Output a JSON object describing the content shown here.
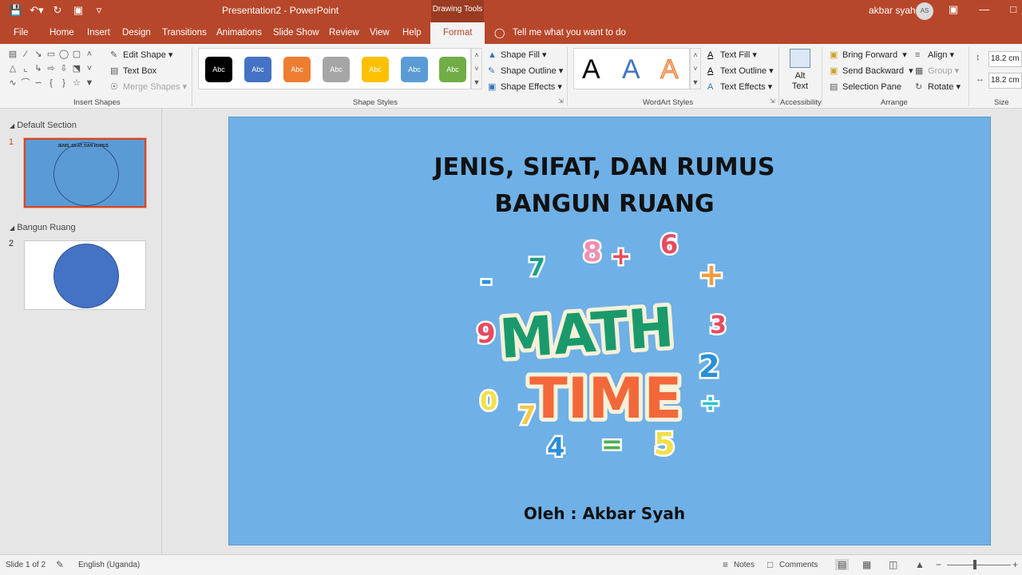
{
  "titlebar": {
    "title": "Presentation2  -  PowerPoint",
    "context_label": "Drawing Tools",
    "user_name": "akbar syah",
    "user_initials": "AS"
  },
  "qat": {
    "save_icon": "save-icon",
    "undo_icon": "undo-icon",
    "redo_icon": "redo-icon",
    "present_icon": "present-icon",
    "customize_icon": "customize-icon"
  },
  "tabs": [
    {
      "label": "File"
    },
    {
      "label": "Home"
    },
    {
      "label": "Insert"
    },
    {
      "label": "Design"
    },
    {
      "label": "Transitions"
    },
    {
      "label": "Animations"
    },
    {
      "label": "Slide Show"
    },
    {
      "label": "Review"
    },
    {
      "label": "View"
    },
    {
      "label": "Help"
    },
    {
      "label": "Format"
    }
  ],
  "tell_me": "Tell me what you want to do",
  "ribbon": {
    "insert_shapes": {
      "label": "Insert Shapes",
      "edit_shape": "Edit Shape",
      "text_box": "Text Box",
      "merge_shapes": "Merge Shapes"
    },
    "shape_styles": {
      "label": "Shape Styles",
      "swatch_text": "Abc",
      "swatch_colors": [
        "#000000",
        "#4472c4",
        "#ed7d31",
        "#a5a5a5",
        "#ffc000",
        "#5b9bd5",
        "#70ad47"
      ],
      "shape_fill": "Shape Fill",
      "shape_outline": "Shape Outline",
      "shape_effects": "Shape Effects"
    },
    "wordart": {
      "label": "WordArt Styles",
      "letter": "A",
      "text_fill": "Text Fill",
      "text_outline": "Text Outline",
      "text_effects": "Text Effects"
    },
    "accessibility": {
      "label": "Accessibility",
      "alt_text_line1": "Alt",
      "alt_text_line2": "Text"
    },
    "arrange": {
      "label": "Arrange",
      "bring_forward": "Bring Forward",
      "send_backward": "Send Backward",
      "selection_pane": "Selection Pane",
      "align": "Align",
      "group": "Group",
      "rotate": "Rotate"
    },
    "size": {
      "label": "Size",
      "height": "18.2 cm",
      "width": "18.2 cm"
    }
  },
  "slides_pane": {
    "sections": [
      {
        "name": "Default Section"
      },
      {
        "name": "Bangun Ruang"
      }
    ],
    "slides": [
      {
        "number": "1",
        "title": "JENIS, SIFAT, DAN RUMUS"
      },
      {
        "number": "2"
      }
    ]
  },
  "slide": {
    "title_line1": "JENIS, SIFAT, DAN RUMUS",
    "title_line2": "BANGUN RUANG",
    "footer": "Oleh : Akbar Syah",
    "art_words": [
      "MATH",
      "TIME"
    ],
    "art_numbers": [
      "8",
      "6",
      "7",
      "3",
      "9",
      "2",
      "0",
      "7",
      "4",
      "5"
    ],
    "art_symbols": [
      "+",
      "+",
      "-",
      "=",
      "÷"
    ],
    "background": "#6fb0e6"
  },
  "statusbar": {
    "slide_info": "Slide 1 of 2",
    "language": "English (Uganda)",
    "notes": "Notes",
    "comments": "Comments"
  },
  "colors": {
    "accent": "#b7472a",
    "selected_border": "#d24726",
    "thumb2_circle": "#4472c4"
  }
}
